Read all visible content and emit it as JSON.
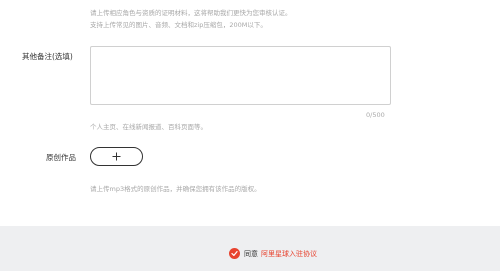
{
  "upload_hint": {
    "line1": "请上传相应角色与资质的证明材料，这将帮助我们更快为您审核认证。",
    "line2": "支持上传常见的图片、音频、文档和zip压缩包，200M以下。"
  },
  "remarks": {
    "label": "其他备注(选填)",
    "value": "",
    "counter": "0/500",
    "hint": "个人主页、在线新闻报道、百科页面等。"
  },
  "original_works": {
    "label": "原创作品",
    "add_icon": "plus-icon",
    "hint": "请上传mp3格式的原创作品，并确保您拥有该作品的版权。"
  },
  "footer": {
    "agree_label": "同意",
    "agreement_link": "阿里星球入驻协议",
    "checked": true,
    "accent_color": "#e8432f"
  }
}
